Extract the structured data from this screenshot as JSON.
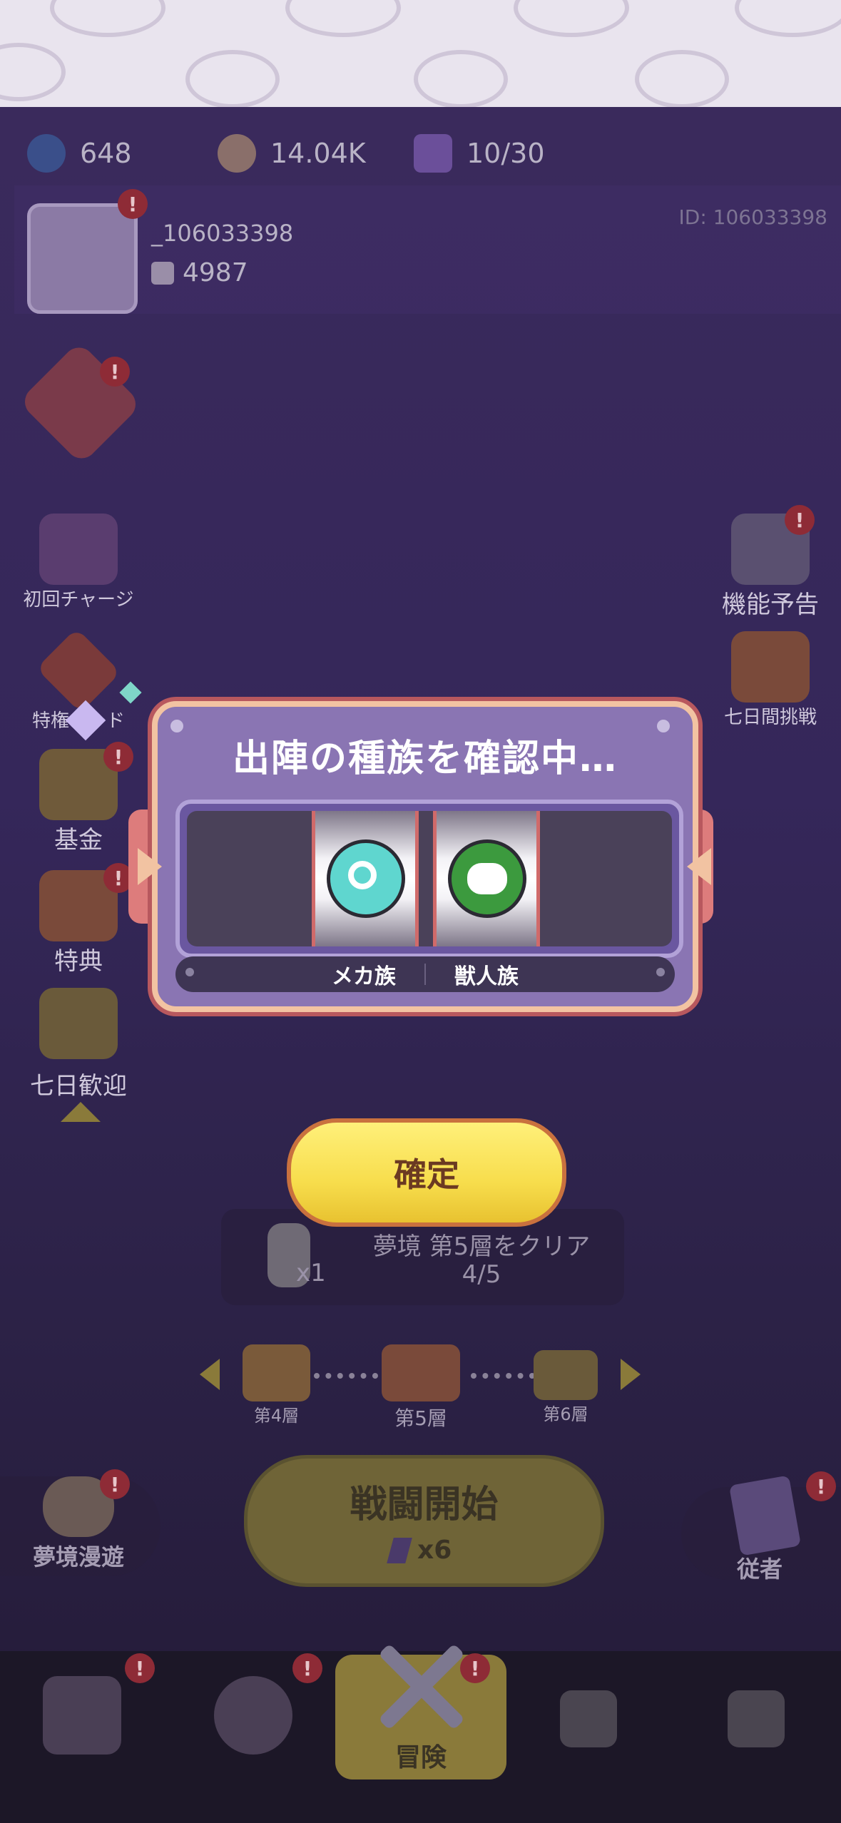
{
  "resources": {
    "gems": "648",
    "coins": "14.04K",
    "energy": "10/30"
  },
  "profile": {
    "name": "_106033398",
    "id_label": "ID: 106033398",
    "power": "4987"
  },
  "badge": "!",
  "left_menu": [
    {
      "label": "初回チャージ",
      "icon": "gift-icon"
    },
    {
      "label": "特権カード",
      "icon": "card-icon"
    },
    {
      "label": "基金",
      "icon": "coins-icon"
    },
    {
      "label": "特典",
      "icon": "chest-icon"
    },
    {
      "label": "七日歓迎",
      "icon": "banana-icon"
    }
  ],
  "right_menu": [
    {
      "label": "機能予告",
      "icon": "magnifier-icon"
    },
    {
      "label": "七日間挑戦",
      "icon": "trophy-icon"
    }
  ],
  "modal": {
    "title": "出陣の種族を確認中…",
    "races": [
      {
        "label": "メカ族",
        "icon": "gear-icon",
        "color": "#5fd6cf"
      },
      {
        "label": "獣人族",
        "icon": "beast-face-icon",
        "color": "#3c9a3e"
      }
    ]
  },
  "confirm_button": "確定",
  "quest": {
    "text": "夢境 第5層をクリア",
    "progress": "4/5",
    "reward_count": "x1"
  },
  "floors": [
    "第4層",
    "第5層",
    "第6層"
  ],
  "bottom_left": {
    "label": "夢境漫遊",
    "icon": "sleeping-wizard-icon"
  },
  "bottom_right": {
    "label": "従者",
    "icon": "cards-icon"
  },
  "battle_button": {
    "label": "戦闘開始",
    "cost": "x6"
  },
  "nav": {
    "active_label": "冒険"
  },
  "colors": {
    "accent_yellow": "#f7dd4c",
    "modal_purple": "#8a75b3",
    "badge_red": "#8e2b36"
  }
}
